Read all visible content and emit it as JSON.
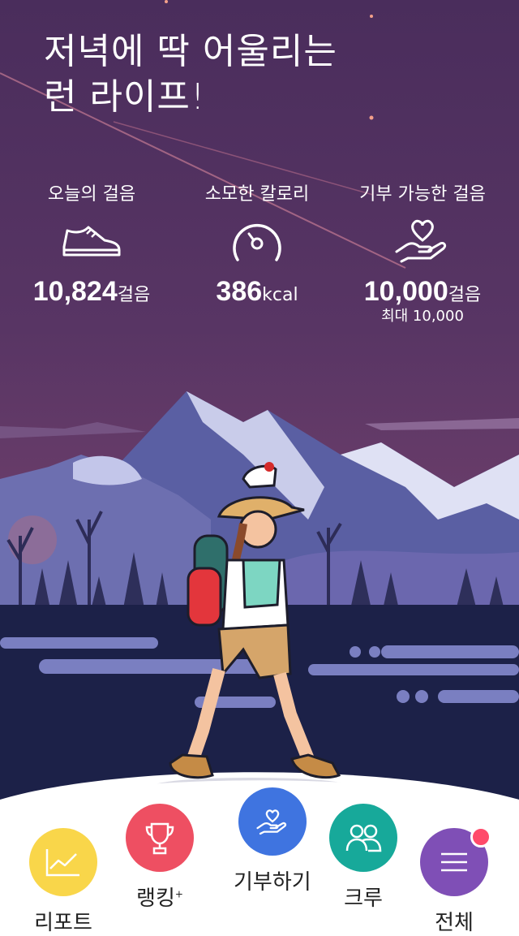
{
  "headline": {
    "line1": "저녁에 딱 어울리는",
    "line2": "런 라이프!"
  },
  "stats": [
    {
      "label": "오늘의 걸음",
      "value": "10,824",
      "unit": "걸음",
      "icon": "sneaker-icon"
    },
    {
      "label": "소모한 칼로리",
      "value": "386",
      "unit": "kcal",
      "icon": "gauge-icon"
    },
    {
      "label": "기부 가능한 걸음",
      "value": "10,000",
      "unit": "걸음",
      "sub": "최대 10,000",
      "icon": "heart-hand-icon"
    }
  ],
  "nav": {
    "report": {
      "label": "리포트",
      "color": "#f9d64a",
      "icon": "chart-icon"
    },
    "ranking": {
      "label": "랭킹",
      "sup": "+",
      "color": "#ee4f62",
      "icon": "trophy-icon"
    },
    "donate": {
      "label": "기부하기",
      "color": "#3f74e0",
      "icon": "heart-hand-icon"
    },
    "crew": {
      "label": "크루",
      "color": "#17a99a",
      "icon": "people-icon"
    },
    "all": {
      "label": "전체",
      "color": "#7f4fb6",
      "icon": "menu-icon"
    }
  }
}
